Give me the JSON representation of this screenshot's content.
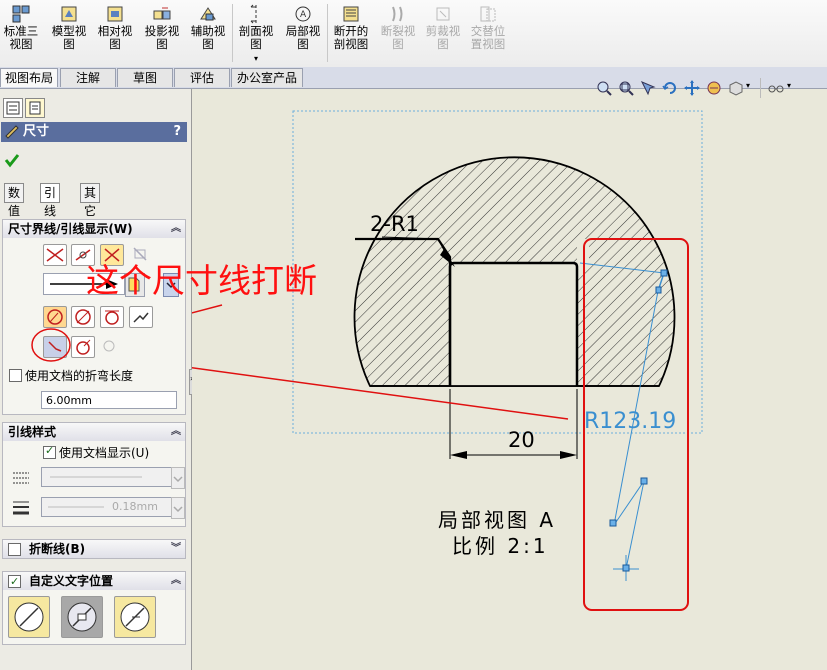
{
  "ribbon": {
    "buttons": [
      {
        "id": "std3view",
        "label1": "标准三",
        "label2": "视图",
        "disabled": false
      },
      {
        "id": "modelview",
        "label1": "模型视",
        "label2": "图",
        "disabled": false
      },
      {
        "id": "relview",
        "label1": "相对视",
        "label2": "图",
        "disabled": false
      },
      {
        "id": "projview",
        "label1": "投影视",
        "label2": "图",
        "disabled": false
      },
      {
        "id": "auxview",
        "label1": "辅助视",
        "label2": "图",
        "disabled": false
      },
      {
        "id": "sectionview",
        "label1": "剖面视",
        "label2": "图",
        "disabled": false
      },
      {
        "id": "detailview",
        "label1": "局部视",
        "label2": "图",
        "disabled": false
      },
      {
        "id": "brokenout",
        "label1": "断开的",
        "label2": "剖视图",
        "disabled": false
      },
      {
        "id": "break",
        "label1": "断裂视",
        "label2": "图",
        "disabled": true
      },
      {
        "id": "crop",
        "label1": "剪裁视",
        "label2": "图",
        "disabled": true
      },
      {
        "id": "altpos",
        "label1": "交替位",
        "label2": "置视图",
        "disabled": true
      }
    ],
    "tabs": [
      "视图布局",
      "注解",
      "草图",
      "评估",
      "办公室产品"
    ]
  },
  "panel": {
    "title": "尺寸",
    "help": "?",
    "subtabs": [
      "数值",
      "引线",
      "其它"
    ],
    "group1": {
      "title": "尺寸界线/引线显示(W)",
      "use_doc_bend_label": "使用文档的折弯长度",
      "use_doc_bend_checked": false,
      "bend_length": "6.00mm"
    },
    "group2": {
      "title": "引线样式",
      "use_doc_display_label": "使用文档显示(U)",
      "use_doc_display_checked": true,
      "thickness_value": "0.18mm"
    },
    "group3": {
      "title": "折断线(B)",
      "checked": false
    },
    "group4": {
      "title": "自定义文字位置",
      "checked": true
    }
  },
  "drawing": {
    "label_2r1": "2-R1",
    "dim_20": "20",
    "radius_dim": "R123.19",
    "view_label": "局部视图 A",
    "scale_label": "比例 2:1"
  },
  "annotation": {
    "text": "这个尺寸线打断",
    "color": "#ff1010"
  },
  "colors": {
    "accent_blue": "#3a8fd0",
    "annotation_red": "#e01010"
  }
}
